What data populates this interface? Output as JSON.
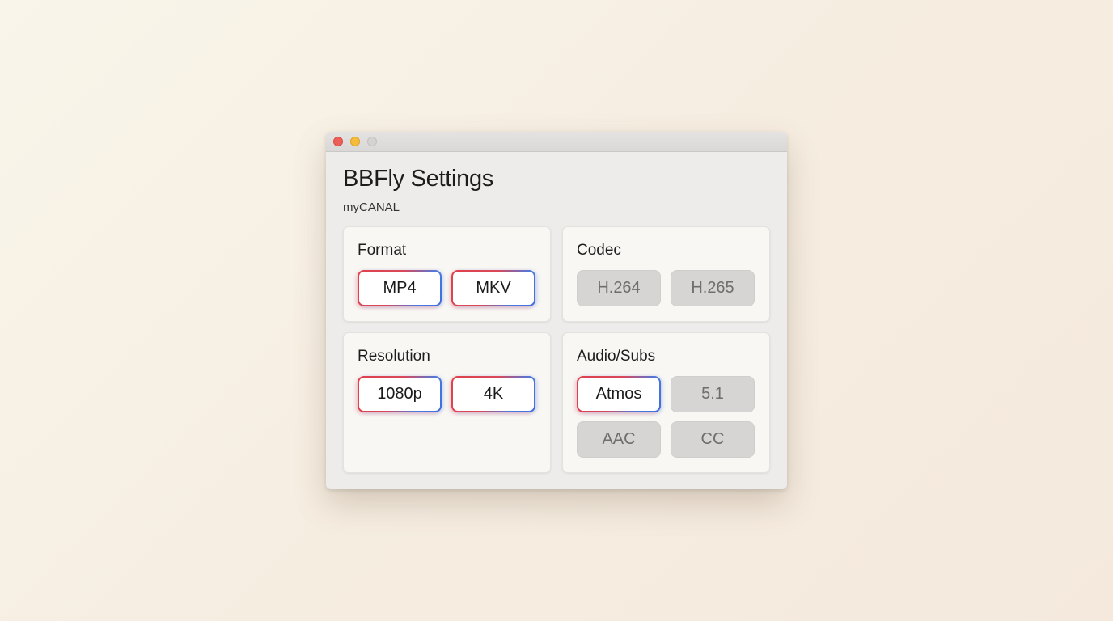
{
  "window": {
    "title": "BBFly Settings",
    "subtitle": "myCANAL"
  },
  "colors": {
    "close": "#ec5f58",
    "minimize": "#f4bc3a",
    "zoom": "#d4d3d1",
    "active_border_start": "#e0414b",
    "active_border_end": "#3d6fe0",
    "inactive_bg": "#d6d5d3"
  },
  "sections": {
    "format": {
      "title": "Format",
      "options": [
        {
          "label": "MP4",
          "selected": true
        },
        {
          "label": "MKV",
          "selected": true
        }
      ]
    },
    "codec": {
      "title": "Codec",
      "options": [
        {
          "label": "H.264",
          "selected": false
        },
        {
          "label": "H.265",
          "selected": false
        }
      ]
    },
    "resolution": {
      "title": "Resolution",
      "options": [
        {
          "label": "1080p",
          "selected": true
        },
        {
          "label": "4K",
          "selected": true
        }
      ]
    },
    "audio": {
      "title": "Audio/Subs",
      "options": [
        {
          "label": "Atmos",
          "selected": true
        },
        {
          "label": "5.1",
          "selected": false
        },
        {
          "label": "AAC",
          "selected": false
        },
        {
          "label": "CC",
          "selected": false
        }
      ]
    }
  }
}
